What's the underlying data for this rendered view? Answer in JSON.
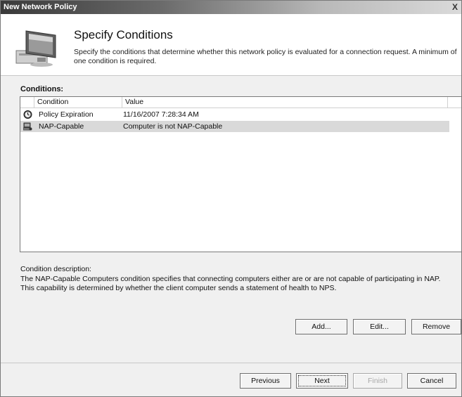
{
  "window": {
    "title": "New Network Policy",
    "close_glyph": "X"
  },
  "header": {
    "title": "Specify Conditions",
    "description": "Specify the conditions that determine whether this network policy is evaluated for a connection request. A minimum of one condition is required.",
    "icon": "computer-icon"
  },
  "conditions": {
    "label": "Conditions:",
    "columns": [
      "Condition",
      "Value"
    ],
    "rows": [
      {
        "icon": "clock-icon",
        "condition": "Policy Expiration",
        "value": "11/16/2007 7:28:34 AM",
        "selected": false
      },
      {
        "icon": "nap-computer-icon",
        "condition": "NAP-Capable",
        "value": "Computer is not NAP-Capable",
        "selected": true
      }
    ]
  },
  "description": {
    "label": "Condition description:",
    "text": "The NAP-Capable Computers condition specifies that connecting computers either are or are not capable of participating in NAP. This capability is determined by whether the client computer sends a statement of health to NPS."
  },
  "actions": {
    "add": "Add...",
    "edit": "Edit...",
    "remove": "Remove"
  },
  "footer": {
    "previous": "Previous",
    "next": "Next",
    "finish": "Finish",
    "cancel": "Cancel"
  }
}
